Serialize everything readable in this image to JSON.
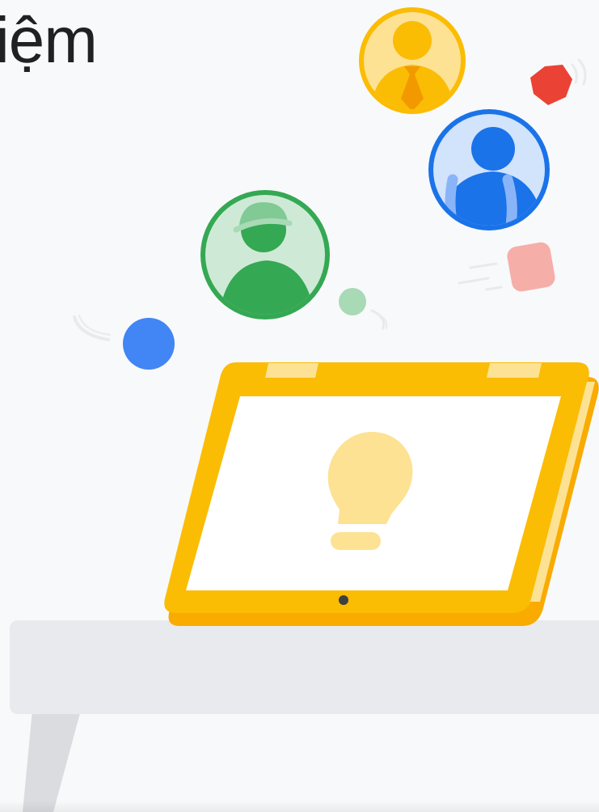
{
  "heading": {
    "text": "iệm"
  },
  "illustration": {
    "avatars": [
      {
        "name": "worker-yellow",
        "icon": "person-tie-icon",
        "ring_color": "#fbbc04",
        "fill_color": "#fde293"
      },
      {
        "name": "worker-blue",
        "icon": "person-backpack-icon",
        "ring_color": "#1a73e8",
        "fill_color": "#d2e3fc"
      },
      {
        "name": "worker-green",
        "icon": "person-cap-icon",
        "ring_color": "#34a853",
        "fill_color": "#ceead6"
      }
    ],
    "laptop": {
      "icon": "lightbulb-icon",
      "frame_color": "#fbbc04",
      "bulb_color": "#fde293"
    },
    "colors": {
      "red": "#ea4335",
      "blue": "#4285f4",
      "pink": "#f6aea9",
      "light_green": "#a8dab5",
      "table": "#e8eaed",
      "table_leg": "#dadce0"
    }
  }
}
